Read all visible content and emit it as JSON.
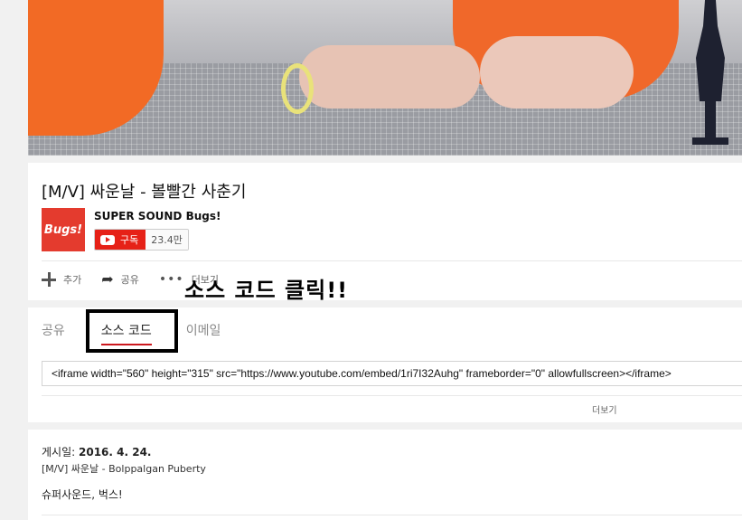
{
  "video": {
    "label": "video-player"
  },
  "info": {
    "title": "[M/V] 싸운날 - 볼빨간 사춘기",
    "channel_logo_text": "Bugs!",
    "channel_name": "SUPER SOUND Bugs!",
    "subscribe_label": "구독",
    "subscriber_count": "23.4만",
    "actions": {
      "add": "추가",
      "share": "공유",
      "more": "더보기"
    }
  },
  "annotation": {
    "text": "소스 코드 클릭!!"
  },
  "share_panel": {
    "tabs": {
      "share": "공유",
      "embed": "소스 코드",
      "email": "이메일"
    },
    "embed_code": "<iframe width=\"560\" height=\"315\" src=\"https://www.youtube.com/embed/1ri7I32Auhg\" frameborder=\"0\" allowfullscreen></iframe>",
    "more_label": "더보기"
  },
  "description": {
    "published_label": "게시일:",
    "published_date": "2016. 4. 24.",
    "line1": "[M/V] 싸운날 - Bolppalgan Puberty",
    "line2": "슈퍼사운드, 벅스!"
  },
  "colors": {
    "subscribe_red": "#e62117",
    "tab_underline": "#cc181e",
    "logo_red": "#e43b2e"
  }
}
